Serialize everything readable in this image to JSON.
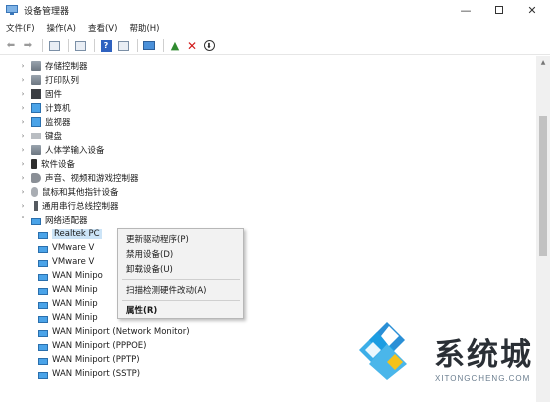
{
  "window": {
    "title": "设备管理器"
  },
  "menubar": [
    "文件(F)",
    "操作(A)",
    "查看(V)",
    "帮助(H)"
  ],
  "toolbar": [
    "back-icon",
    "forward-icon",
    "properties-icon",
    "scan-icon",
    "help-icon",
    "monitor-icon",
    "update-driver-icon",
    "uninstall-icon",
    "download-icon"
  ],
  "tree": {
    "categories": [
      {
        "label": "存储控制器",
        "icon": "storage-icon",
        "expanded": false
      },
      {
        "label": "打印队列",
        "icon": "printer-icon",
        "expanded": false
      },
      {
        "label": "固件",
        "icon": "firmware-icon",
        "expanded": false
      },
      {
        "label": "计算机",
        "icon": "computer-icon",
        "expanded": false
      },
      {
        "label": "监视器",
        "icon": "monitor-icon",
        "expanded": false
      },
      {
        "label": "键盘",
        "icon": "keyboard-icon",
        "expanded": false
      },
      {
        "label": "人体学输入设备",
        "icon": "hid-icon",
        "expanded": false
      },
      {
        "label": "软件设备",
        "icon": "software-device-icon",
        "expanded": false
      },
      {
        "label": "声音、视频和游戏控制器",
        "icon": "speaker-icon",
        "expanded": false
      },
      {
        "label": "鼠标和其他指针设备",
        "icon": "mouse-icon",
        "expanded": false
      },
      {
        "label": "通用串行总线控制器",
        "icon": "usb-icon",
        "expanded": false
      },
      {
        "label": "网络适配器",
        "icon": "network-adapter-icon",
        "expanded": true
      }
    ],
    "network_adapters": [
      "Realtek PC",
      "VMware V",
      "VMware V",
      "WAN Minipo",
      "WAN Minip",
      "WAN Minip",
      "WAN Minip",
      "WAN Miniport (Network Monitor)",
      "WAN Miniport (PPPOE)",
      "WAN Miniport (PPTP)",
      "WAN Miniport (SSTP)"
    ]
  },
  "context_menu": {
    "items": [
      "更新驱动程序(P)",
      "禁用设备(D)",
      "卸载设备(U)",
      "扫描检测硬件改动(A)",
      "属性(R)"
    ]
  },
  "watermark": {
    "text_cn": "系统城",
    "text_en": "XITONGCHENG.COM"
  }
}
